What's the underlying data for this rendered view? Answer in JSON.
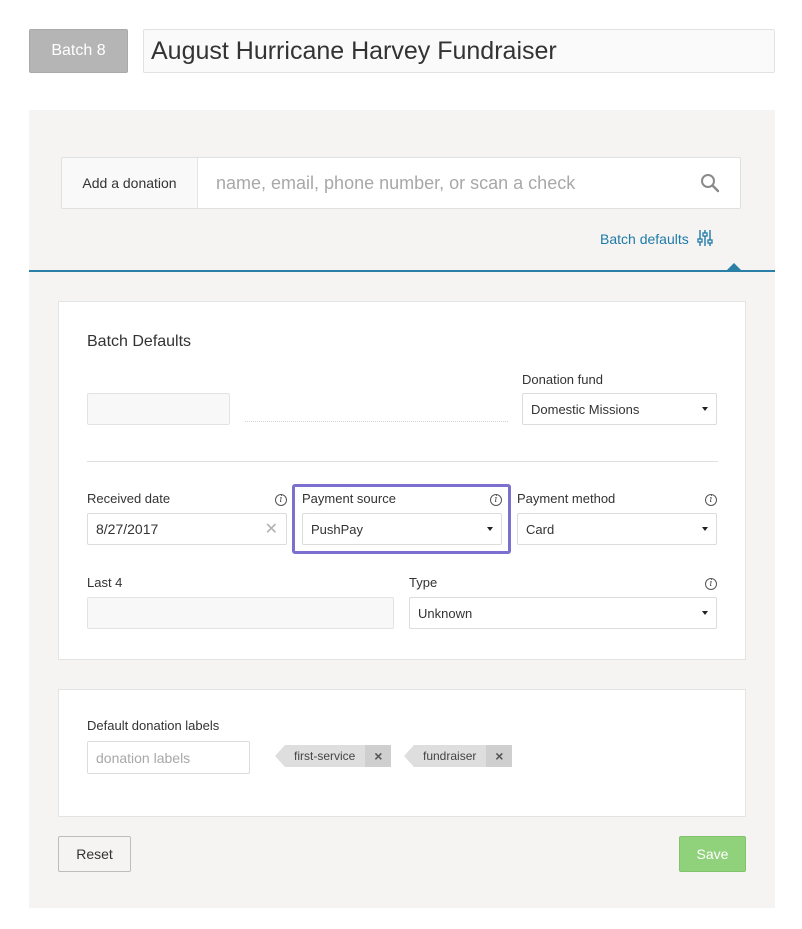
{
  "header": {
    "batch_label": "Batch 8",
    "batch_title": "August Hurricane Harvey Fundraiser"
  },
  "donation_bar": {
    "label": "Add a donation",
    "search_placeholder": "name, email, phone number, or scan a check",
    "search_icon": "search-icon"
  },
  "batch_defaults_link": {
    "label": "Batch defaults",
    "icon": "sliders-icon"
  },
  "defaults_card": {
    "title": "Batch Defaults",
    "donation_fund": {
      "label": "Donation fund",
      "value": "Domestic Missions"
    },
    "received_date": {
      "label": "Received date",
      "value": "8/27/2017"
    },
    "payment_source": {
      "label": "Payment source",
      "value": "PushPay"
    },
    "payment_method": {
      "label": "Payment method",
      "value": "Card"
    },
    "last4": {
      "label": "Last 4",
      "value": ""
    },
    "type": {
      "label": "Type",
      "value": "Unknown"
    }
  },
  "labels_card": {
    "label": "Default donation labels",
    "placeholder": "donation labels",
    "tags": [
      "first-service",
      "fundraiser"
    ]
  },
  "buttons": {
    "reset": "Reset",
    "save": "Save"
  },
  "colors": {
    "accent_blue": "#2a7fa6",
    "highlight_purple": "#7b6fd0",
    "save_green": "#90d17b",
    "panel_grey": "#f5f4f2"
  }
}
